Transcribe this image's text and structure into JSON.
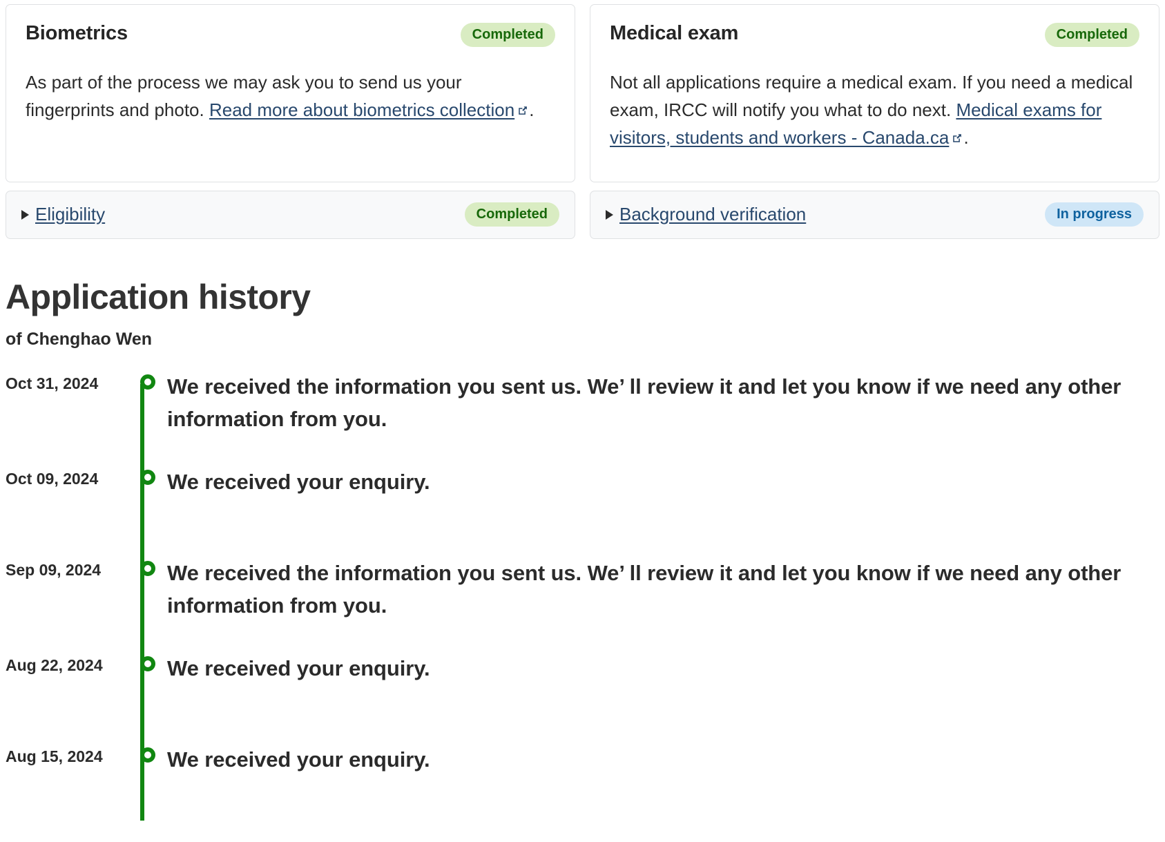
{
  "cards": [
    {
      "title": "Biometrics",
      "status": "Completed",
      "status_type": "completed",
      "body_before": "As part of the process we may ask you to send us your fingerprints and photo. ",
      "link_text": "Read more about biometrics collection",
      "link_icon": "external-link-icon",
      "body_after": "."
    },
    {
      "title": "Medical exam",
      "status": "Completed",
      "status_type": "completed",
      "body_before": "Not all applications require a medical exam. If you need a medical exam, IRCC will notify you what to do next. ",
      "link_text": "Medical exams for visitors, students and workers - Canada.ca",
      "link_icon": "external-link-icon",
      "body_after": "."
    }
  ],
  "accordions": [
    {
      "label": "Eligibility",
      "status": "Completed",
      "status_type": "completed",
      "marker": "disclosure-triangle-icon"
    },
    {
      "label": "Background verification",
      "status": "In progress",
      "status_type": "in-progress",
      "marker": "disclosure-triangle-icon"
    }
  ],
  "history": {
    "title": "Application history",
    "subtitle": "of Chenghao Wen",
    "entries": [
      {
        "date": "Oct 31, 2024",
        "text": "We received the information you sent us. We’  ll review it and let you know if we need any other information from you."
      },
      {
        "date": "Oct 09, 2024",
        "text": "We received your enquiry."
      },
      {
        "date": "Sep 09, 2024",
        "text": "We received the information you sent us. We’  ll review it and let you know if we need any other information from you."
      },
      {
        "date": "Aug 22, 2024",
        "text": "We received your enquiry."
      },
      {
        "date": "Aug 15, 2024",
        "text": "We received your enquiry."
      }
    ]
  },
  "colors": {
    "completed_bg": "#d9ecc2",
    "completed_fg": "#17680a",
    "inprogress_bg": "#cfe6f7",
    "inprogress_fg": "#0f629f",
    "link": "#28486d",
    "timeline": "#118711",
    "card_border": "#dfe1e3",
    "accordion_bg": "#f8f9fa"
  }
}
